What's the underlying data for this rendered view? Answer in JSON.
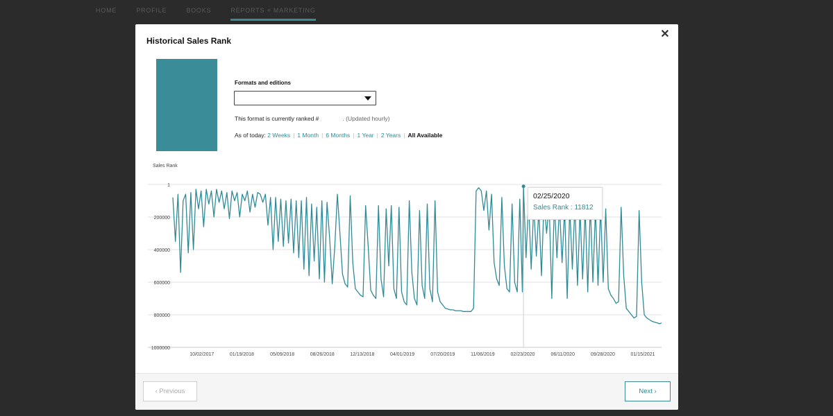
{
  "nav": {
    "items": [
      {
        "label": "HOME"
      },
      {
        "label": "PROFILE"
      },
      {
        "label": "BOOKS"
      },
      {
        "label": "REPORTS + MARKETING"
      }
    ]
  },
  "modal": {
    "title": "Historical Sales Rank",
    "close_icon": "close-icon",
    "formats_label": "Formats and editions",
    "format_select": {
      "value": ""
    },
    "rank_prefix": "This format is currently ranked #",
    "rank_value": "",
    "rank_suffix": ". (Updated hourly)",
    "as_of_label": "As of today:",
    "ranges": [
      "2 Weeks",
      "1 Month",
      "6 Months",
      "1 Year",
      "2 Years"
    ],
    "current_range": "All Available",
    "cover_color": "#3b8c99"
  },
  "tooltip": {
    "date": "02/25/2020",
    "label": "Sales Rank : 11812"
  },
  "footer": {
    "previous_label": "‹  Previous",
    "next_label": "Next  ›"
  },
  "chart_data": {
    "type": "line",
    "title": "",
    "ylabel": "Sales Rank",
    "xlabel": "",
    "y_inverted": true,
    "ylim": [
      1,
      1000000
    ],
    "y_ticks": [
      1,
      200000,
      400000,
      600000,
      800000,
      1000000
    ],
    "y_tick_labels": [
      "1",
      "200000",
      "400000",
      "600000",
      "800000",
      "1000000"
    ],
    "x_ticks": [
      "10/02/2017",
      "01/19/2018",
      "05/09/2018",
      "08/26/2018",
      "12/13/2018",
      "04/01/2019",
      "07/20/2019",
      "11/06/2019",
      "02/23/2020",
      "06/11/2020",
      "09/28/2020",
      "01/15/2021"
    ],
    "x_range": [
      "07/15/2017",
      "03/07/2021"
    ],
    "highlight": {
      "x": "02/25/2020",
      "y": 11812
    },
    "line_color": "#2e8a97",
    "series": [
      {
        "values": [
          [
            "07/15/2017",
            80000
          ],
          [
            "07/22/2017",
            350000
          ],
          [
            "07/29/2017",
            60000
          ],
          [
            "08/05/2017",
            540000
          ],
          [
            "08/12/2017",
            100000
          ],
          [
            "08/19/2017",
            60000
          ],
          [
            "08/26/2017",
            420000
          ],
          [
            "09/02/2017",
            50000
          ],
          [
            "09/09/2017",
            400000
          ],
          [
            "09/16/2017",
            30000
          ],
          [
            "09/23/2017",
            150000
          ],
          [
            "09/30/2017",
            40000
          ],
          [
            "10/07/2017",
            260000
          ],
          [
            "10/14/2017",
            30000
          ],
          [
            "10/21/2017",
            120000
          ],
          [
            "10/28/2017",
            40000
          ],
          [
            "11/04/2017",
            200000
          ],
          [
            "11/11/2017",
            30000
          ],
          [
            "11/18/2017",
            110000
          ],
          [
            "11/25/2017",
            40000
          ],
          [
            "12/02/2017",
            150000
          ],
          [
            "12/09/2017",
            50000
          ],
          [
            "12/16/2017",
            210000
          ],
          [
            "12/23/2017",
            40000
          ],
          [
            "12/30/2017",
            100000
          ],
          [
            "01/06/2018",
            50000
          ],
          [
            "01/13/2018",
            200000
          ],
          [
            "01/20/2018",
            60000
          ],
          [
            "01/27/2018",
            100000
          ],
          [
            "02/03/2018",
            40000
          ],
          [
            "02/10/2018",
            170000
          ],
          [
            "02/17/2018",
            60000
          ],
          [
            "02/24/2018",
            140000
          ],
          [
            "03/03/2018",
            50000
          ],
          [
            "03/10/2018",
            60000
          ],
          [
            "03/17/2018",
            110000
          ],
          [
            "03/24/2018",
            60000
          ],
          [
            "03/31/2018",
            250000
          ],
          [
            "04/07/2018",
            80000
          ],
          [
            "04/14/2018",
            400000
          ],
          [
            "04/21/2018",
            80000
          ],
          [
            "04/28/2018",
            350000
          ],
          [
            "05/05/2018",
            90000
          ],
          [
            "05/12/2018",
            380000
          ],
          [
            "05/19/2018",
            100000
          ],
          [
            "05/26/2018",
            360000
          ],
          [
            "06/02/2018",
            90000
          ],
          [
            "06/09/2018",
            420000
          ],
          [
            "06/16/2018",
            100000
          ],
          [
            "06/23/2018",
            450000
          ],
          [
            "06/30/2018",
            100000
          ],
          [
            "07/07/2018",
            520000
          ],
          [
            "07/14/2018",
            80000
          ],
          [
            "07/21/2018",
            560000
          ],
          [
            "07/28/2018",
            120000
          ],
          [
            "08/04/2018",
            470000
          ],
          [
            "08/11/2018",
            140000
          ],
          [
            "08/18/2018",
            580000
          ],
          [
            "08/25/2018",
            100000
          ],
          [
            "09/01/2018",
            600000
          ],
          [
            "09/08/2018",
            110000
          ],
          [
            "09/15/2018",
            330000
          ],
          [
            "09/22/2018",
            610000
          ],
          [
            "09/29/2018",
            380000
          ],
          [
            "10/06/2018",
            60000
          ],
          [
            "10/13/2018",
            300000
          ],
          [
            "10/20/2018",
            550000
          ],
          [
            "10/27/2018",
            610000
          ],
          [
            "11/03/2018",
            630000
          ],
          [
            "11/10/2018",
            70000
          ],
          [
            "11/17/2018",
            480000
          ],
          [
            "11/24/2018",
            640000
          ],
          [
            "12/01/2018",
            660000
          ],
          [
            "12/08/2018",
            680000
          ],
          [
            "12/15/2018",
            690000
          ],
          [
            "12/22/2018",
            130000
          ],
          [
            "12/29/2018",
            380000
          ],
          [
            "01/05/2019",
            650000
          ],
          [
            "01/12/2019",
            680000
          ],
          [
            "01/19/2019",
            700000
          ],
          [
            "01/26/2019",
            130000
          ],
          [
            "02/02/2019",
            580000
          ],
          [
            "02/09/2019",
            690000
          ],
          [
            "02/16/2019",
            150000
          ],
          [
            "02/23/2019",
            500000
          ],
          [
            "03/02/2019",
            130000
          ],
          [
            "03/09/2019",
            640000
          ],
          [
            "03/16/2019",
            700000
          ],
          [
            "03/23/2019",
            140000
          ],
          [
            "03/30/2019",
            660000
          ],
          [
            "04/06/2019",
            720000
          ],
          [
            "04/13/2019",
            740000
          ],
          [
            "04/20/2019",
            100000
          ],
          [
            "04/27/2019",
            540000
          ],
          [
            "05/04/2019",
            700000
          ],
          [
            "05/11/2019",
            740000
          ],
          [
            "05/18/2019",
            160000
          ],
          [
            "05/25/2019",
            620000
          ],
          [
            "06/01/2019",
            700000
          ],
          [
            "06/08/2019",
            120000
          ],
          [
            "06/15/2019",
            640000
          ],
          [
            "06/22/2019",
            720000
          ],
          [
            "06/29/2019",
            100000
          ],
          [
            "07/06/2019",
            660000
          ],
          [
            "07/13/2019",
            720000
          ],
          [
            "07/20/2019",
            740000
          ],
          [
            "07/27/2019",
            760000
          ],
          [
            "08/03/2019",
            765000
          ],
          [
            "08/10/2019",
            770000
          ],
          [
            "08/17/2019",
            770000
          ],
          [
            "08/24/2019",
            775000
          ],
          [
            "08/31/2019",
            775000
          ],
          [
            "09/07/2019",
            775000
          ],
          [
            "09/14/2019",
            780000
          ],
          [
            "09/21/2019",
            780000
          ],
          [
            "09/28/2019",
            780000
          ],
          [
            "10/05/2019",
            780000
          ],
          [
            "10/12/2019",
            760000
          ],
          [
            "10/19/2019",
            40000
          ],
          [
            "10/26/2019",
            20000
          ],
          [
            "11/02/2019",
            40000
          ],
          [
            "11/09/2019",
            160000
          ],
          [
            "11/16/2019",
            40000
          ],
          [
            "11/23/2019",
            280000
          ],
          [
            "11/30/2019",
            60000
          ],
          [
            "12/07/2019",
            480000
          ],
          [
            "12/14/2019",
            580000
          ],
          [
            "12/21/2019",
            620000
          ],
          [
            "12/28/2019",
            80000
          ],
          [
            "01/04/2020",
            500000
          ],
          [
            "01/11/2020",
            640000
          ],
          [
            "01/18/2020",
            660000
          ],
          [
            "01/25/2020",
            120000
          ],
          [
            "02/01/2020",
            600000
          ],
          [
            "02/08/2020",
            660000
          ],
          [
            "02/15/2020",
            90000
          ],
          [
            "02/22/2020",
            660000
          ],
          [
            "02/25/2020",
            11812
          ],
          [
            "03/03/2020",
            450000
          ],
          [
            "03/10/2020",
            100000
          ],
          [
            "03/17/2020",
            520000
          ],
          [
            "03/24/2020",
            130000
          ],
          [
            "03/31/2020",
            440000
          ],
          [
            "04/07/2020",
            150000
          ],
          [
            "04/14/2020",
            560000
          ],
          [
            "04/21/2020",
            100000
          ],
          [
            "04/28/2020",
            300000
          ],
          [
            "05/05/2020",
            120000
          ],
          [
            "05/12/2020",
            700000
          ],
          [
            "05/19/2020",
            110000
          ],
          [
            "05/26/2020",
            450000
          ],
          [
            "06/02/2020",
            130000
          ],
          [
            "06/09/2020",
            480000
          ],
          [
            "06/16/2020",
            150000
          ],
          [
            "06/23/2020",
            700000
          ],
          [
            "06/30/2020",
            140000
          ],
          [
            "07/07/2020",
            520000
          ],
          [
            "07/14/2020",
            120000
          ],
          [
            "07/21/2020",
            620000
          ],
          [
            "07/28/2020",
            160000
          ],
          [
            "08/04/2020",
            580000
          ],
          [
            "08/11/2020",
            150000
          ],
          [
            "08/18/2020",
            660000
          ],
          [
            "08/25/2020",
            120000
          ],
          [
            "09/01/2020",
            600000
          ],
          [
            "09/08/2020",
            150000
          ],
          [
            "09/15/2020",
            620000
          ],
          [
            "09/22/2020",
            140000
          ],
          [
            "09/29/2020",
            600000
          ],
          [
            "10/06/2020",
            150000
          ],
          [
            "10/13/2020",
            640000
          ],
          [
            "10/20/2020",
            680000
          ],
          [
            "10/27/2020",
            700000
          ],
          [
            "11/03/2020",
            730000
          ],
          [
            "11/10/2020",
            720000
          ],
          [
            "11/17/2020",
            140000
          ],
          [
            "11/24/2020",
            560000
          ],
          [
            "12/01/2020",
            760000
          ],
          [
            "12/08/2020",
            780000
          ],
          [
            "12/15/2020",
            800000
          ],
          [
            "12/22/2020",
            820000
          ],
          [
            "12/29/2020",
            810000
          ],
          [
            "01/05/2021",
            160000
          ],
          [
            "01/12/2021",
            600000
          ],
          [
            "01/19/2021",
            800000
          ],
          [
            "01/26/2021",
            820000
          ],
          [
            "02/02/2021",
            830000
          ],
          [
            "02/09/2021",
            840000
          ],
          [
            "02/16/2021",
            845000
          ],
          [
            "02/23/2021",
            850000
          ],
          [
            "03/02/2021",
            855000
          ],
          [
            "03/07/2021",
            850000
          ]
        ]
      }
    ]
  }
}
